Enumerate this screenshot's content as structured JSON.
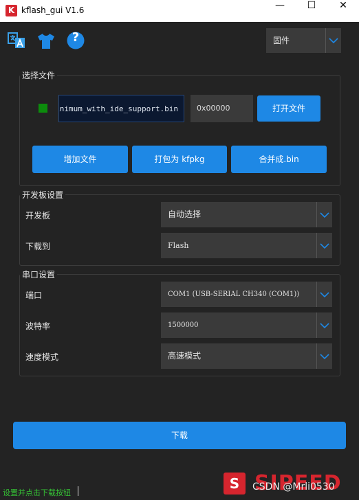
{
  "window": {
    "title": "kflash_gui V1.6",
    "app_icon_letter": "K",
    "minimize": "—",
    "maximize": "☐",
    "close": "✕"
  },
  "toolbar": {
    "icons": [
      "language-icon",
      "shirt-icon",
      "help-icon"
    ],
    "help_glyph": "?",
    "mode_select": "固件"
  },
  "file_group": {
    "title": "选择文件",
    "file_path": "inimum_with_ide_support.bin",
    "address": "0x00000",
    "open_button": "打开文件",
    "add_button": "增加文件",
    "pack_button": "打包为 kfpkg",
    "merge_button": "合并成.bin",
    "status_color": "#0c8c0c"
  },
  "board_group": {
    "title": "开发板设置",
    "board_label": "开发板",
    "board_value": "自动选择",
    "target_label": "下载到",
    "target_value": "Flash"
  },
  "serial_group": {
    "title": "串口设置",
    "port_label": "端口",
    "port_value": "COM1 (USB-SERIAL CH340 (COM1))",
    "baud_label": "波特率",
    "baud_value": "1500000",
    "speed_label": "速度模式",
    "speed_value": "高速模式"
  },
  "download_button": "下载",
  "status_text": "设置并点击下载按钮",
  "watermark": {
    "logo_letter": "S",
    "logo_text": "SIPEED",
    "csdn": "CSDN @Mrli0530"
  },
  "colors": {
    "accent": "#1e88e5",
    "background": "#232323",
    "field": "#3a3a3a",
    "status_green": "#35c135"
  }
}
